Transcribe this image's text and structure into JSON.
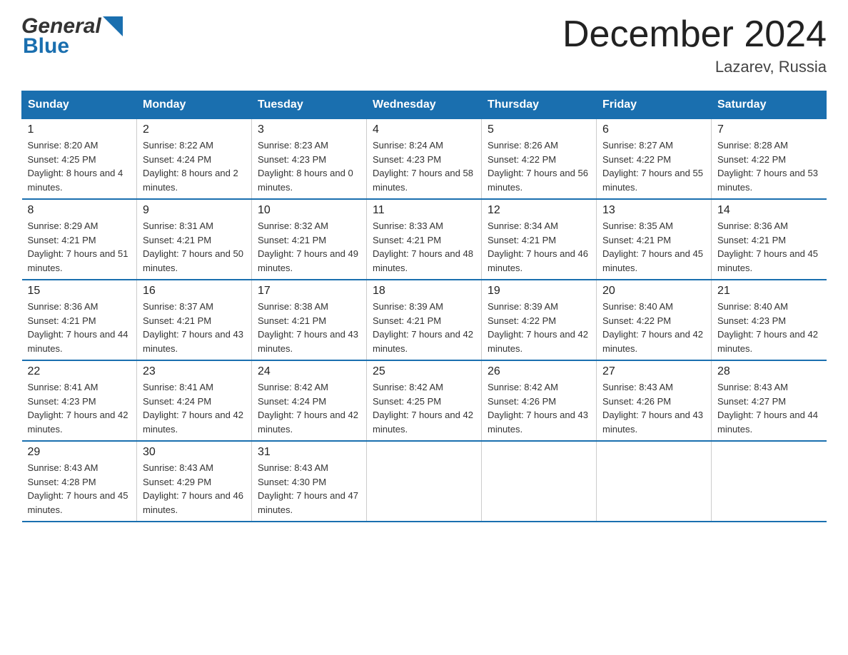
{
  "header": {
    "logo_general": "General",
    "logo_blue": "Blue",
    "title": "December 2024",
    "location": "Lazarev, Russia"
  },
  "days_of_week": [
    "Sunday",
    "Monday",
    "Tuesday",
    "Wednesday",
    "Thursday",
    "Friday",
    "Saturday"
  ],
  "weeks": [
    [
      {
        "day": "1",
        "sunrise": "8:20 AM",
        "sunset": "4:25 PM",
        "daylight": "8 hours and 4 minutes."
      },
      {
        "day": "2",
        "sunrise": "8:22 AM",
        "sunset": "4:24 PM",
        "daylight": "8 hours and 2 minutes."
      },
      {
        "day": "3",
        "sunrise": "8:23 AM",
        "sunset": "4:23 PM",
        "daylight": "8 hours and 0 minutes."
      },
      {
        "day": "4",
        "sunrise": "8:24 AM",
        "sunset": "4:23 PM",
        "daylight": "7 hours and 58 minutes."
      },
      {
        "day": "5",
        "sunrise": "8:26 AM",
        "sunset": "4:22 PM",
        "daylight": "7 hours and 56 minutes."
      },
      {
        "day": "6",
        "sunrise": "8:27 AM",
        "sunset": "4:22 PM",
        "daylight": "7 hours and 55 minutes."
      },
      {
        "day": "7",
        "sunrise": "8:28 AM",
        "sunset": "4:22 PM",
        "daylight": "7 hours and 53 minutes."
      }
    ],
    [
      {
        "day": "8",
        "sunrise": "8:29 AM",
        "sunset": "4:21 PM",
        "daylight": "7 hours and 51 minutes."
      },
      {
        "day": "9",
        "sunrise": "8:31 AM",
        "sunset": "4:21 PM",
        "daylight": "7 hours and 50 minutes."
      },
      {
        "day": "10",
        "sunrise": "8:32 AM",
        "sunset": "4:21 PM",
        "daylight": "7 hours and 49 minutes."
      },
      {
        "day": "11",
        "sunrise": "8:33 AM",
        "sunset": "4:21 PM",
        "daylight": "7 hours and 48 minutes."
      },
      {
        "day": "12",
        "sunrise": "8:34 AM",
        "sunset": "4:21 PM",
        "daylight": "7 hours and 46 minutes."
      },
      {
        "day": "13",
        "sunrise": "8:35 AM",
        "sunset": "4:21 PM",
        "daylight": "7 hours and 45 minutes."
      },
      {
        "day": "14",
        "sunrise": "8:36 AM",
        "sunset": "4:21 PM",
        "daylight": "7 hours and 45 minutes."
      }
    ],
    [
      {
        "day": "15",
        "sunrise": "8:36 AM",
        "sunset": "4:21 PM",
        "daylight": "7 hours and 44 minutes."
      },
      {
        "day": "16",
        "sunrise": "8:37 AM",
        "sunset": "4:21 PM",
        "daylight": "7 hours and 43 minutes."
      },
      {
        "day": "17",
        "sunrise": "8:38 AM",
        "sunset": "4:21 PM",
        "daylight": "7 hours and 43 minutes."
      },
      {
        "day": "18",
        "sunrise": "8:39 AM",
        "sunset": "4:21 PM",
        "daylight": "7 hours and 42 minutes."
      },
      {
        "day": "19",
        "sunrise": "8:39 AM",
        "sunset": "4:22 PM",
        "daylight": "7 hours and 42 minutes."
      },
      {
        "day": "20",
        "sunrise": "8:40 AM",
        "sunset": "4:22 PM",
        "daylight": "7 hours and 42 minutes."
      },
      {
        "day": "21",
        "sunrise": "8:40 AM",
        "sunset": "4:23 PM",
        "daylight": "7 hours and 42 minutes."
      }
    ],
    [
      {
        "day": "22",
        "sunrise": "8:41 AM",
        "sunset": "4:23 PM",
        "daylight": "7 hours and 42 minutes."
      },
      {
        "day": "23",
        "sunrise": "8:41 AM",
        "sunset": "4:24 PM",
        "daylight": "7 hours and 42 minutes."
      },
      {
        "day": "24",
        "sunrise": "8:42 AM",
        "sunset": "4:24 PM",
        "daylight": "7 hours and 42 minutes."
      },
      {
        "day": "25",
        "sunrise": "8:42 AM",
        "sunset": "4:25 PM",
        "daylight": "7 hours and 42 minutes."
      },
      {
        "day": "26",
        "sunrise": "8:42 AM",
        "sunset": "4:26 PM",
        "daylight": "7 hours and 43 minutes."
      },
      {
        "day": "27",
        "sunrise": "8:43 AM",
        "sunset": "4:26 PM",
        "daylight": "7 hours and 43 minutes."
      },
      {
        "day": "28",
        "sunrise": "8:43 AM",
        "sunset": "4:27 PM",
        "daylight": "7 hours and 44 minutes."
      }
    ],
    [
      {
        "day": "29",
        "sunrise": "8:43 AM",
        "sunset": "4:28 PM",
        "daylight": "7 hours and 45 minutes."
      },
      {
        "day": "30",
        "sunrise": "8:43 AM",
        "sunset": "4:29 PM",
        "daylight": "7 hours and 46 minutes."
      },
      {
        "day": "31",
        "sunrise": "8:43 AM",
        "sunset": "4:30 PM",
        "daylight": "7 hours and 47 minutes."
      },
      null,
      null,
      null,
      null
    ]
  ],
  "labels": {
    "sunrise": "Sunrise:",
    "sunset": "Sunset:",
    "daylight": "Daylight:"
  }
}
